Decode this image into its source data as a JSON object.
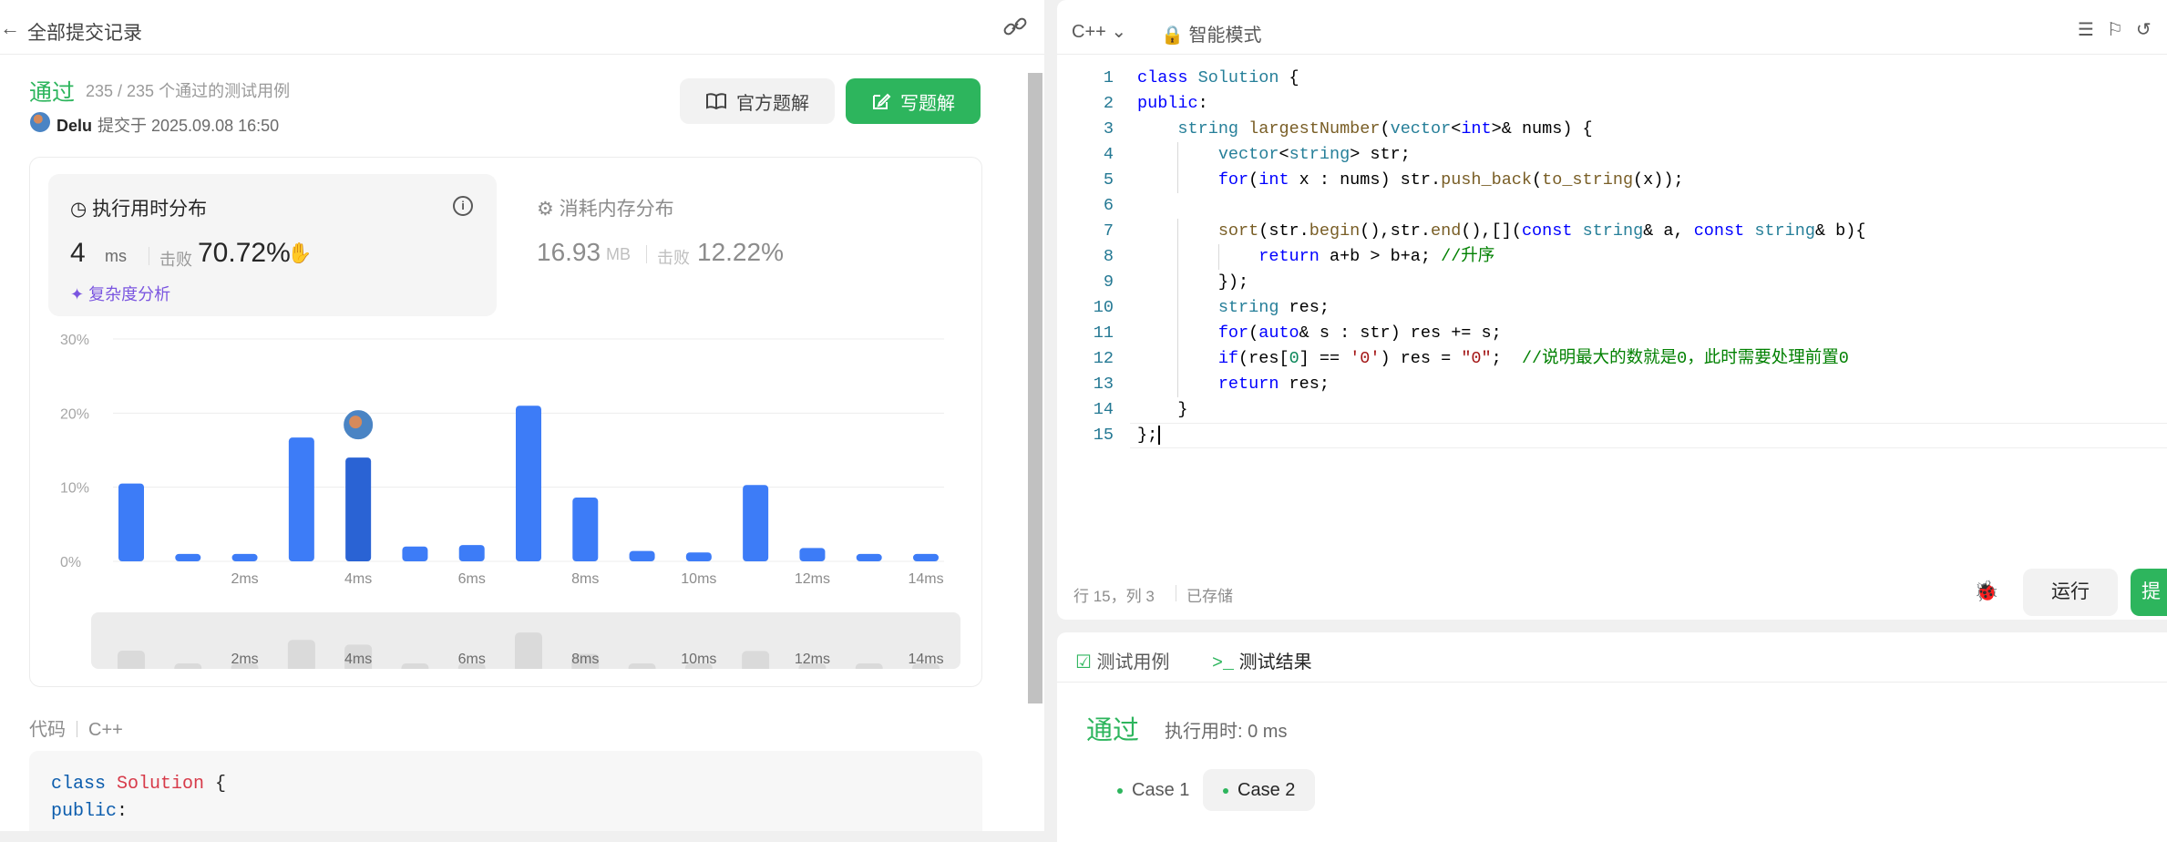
{
  "left": {
    "header_title": "全部提交记录",
    "status": "通过",
    "passed_cases": "235 / 235 个通过的测试用例",
    "submitter_name": "Delu",
    "submitted_at": "提交于 2025.09.08 16:50",
    "btn_official": "官方题解",
    "btn_write": "写题解",
    "runtime": {
      "label": "执行用时分布",
      "value": "4",
      "unit": "ms",
      "beat_label": "击败",
      "beat_pct": "70.72%",
      "complexity": "复杂度分析"
    },
    "memory": {
      "label": "消耗内存分布",
      "value": "16.93",
      "unit": "MB",
      "beat_label": "击败",
      "beat_pct": "12.22%"
    },
    "code_label": "代码",
    "code_lang": "C++",
    "code_preview": [
      "class Solution {",
      "public:"
    ]
  },
  "chart_data": {
    "type": "bar",
    "title": "",
    "xlabel": "",
    "ylabel": "",
    "ylim": [
      0,
      30
    ],
    "yticks": [
      "0%",
      "10%",
      "20%",
      "30%"
    ],
    "xticks": [
      {
        "at": 2,
        "label": "2ms"
      },
      {
        "at": 4,
        "label": "4ms"
      },
      {
        "at": 6,
        "label": "6ms"
      },
      {
        "at": 8,
        "label": "8ms"
      },
      {
        "at": 10,
        "label": "10ms"
      },
      {
        "at": 12,
        "label": "12ms"
      },
      {
        "at": 14,
        "label": "14ms"
      }
    ],
    "x": [
      0,
      1,
      2,
      3,
      4,
      5,
      6,
      7,
      8,
      9,
      10,
      11,
      12,
      13,
      14
    ],
    "values": [
      10.5,
      1,
      1,
      16.7,
      14,
      2,
      2.2,
      21,
      8.6,
      1.4,
      1.2,
      10.3,
      1.8,
      1,
      1
    ],
    "highlight_index": 4,
    "grid": true,
    "bar_color": "#3d7cf7",
    "highlight_color": "#2a63d4"
  },
  "editor": {
    "lang": "C++",
    "mode": "智能模式",
    "cursor_pos": "行 15，列 3",
    "saved": "已存储",
    "run_label": "运行",
    "submit_label": "提"
  },
  "code_lines": [
    "class Solution {",
    "public:",
    "    string largestNumber(vector<int>& nums) {",
    "        vector<string> str;",
    "        for(int x : nums) str.push_back(to_string(x));",
    "",
    "        sort(str.begin(),str.end(),[](const string& a, const string& b){",
    "            return a+b > b+a; //升序",
    "        });",
    "        string res;",
    "        for(auto& s : str) res += s;",
    "        if(res[0] == '0') res = \"0\";  //说明最大的数就是0，此时需要处理前置0",
    "        return res;",
    "    }",
    "};"
  ],
  "tests": {
    "tab_cases": "测试用例",
    "tab_results": "测试结果",
    "status": "通过",
    "time": "执行用时: 0 ms",
    "case1": "Case 1",
    "case2": "Case 2"
  }
}
